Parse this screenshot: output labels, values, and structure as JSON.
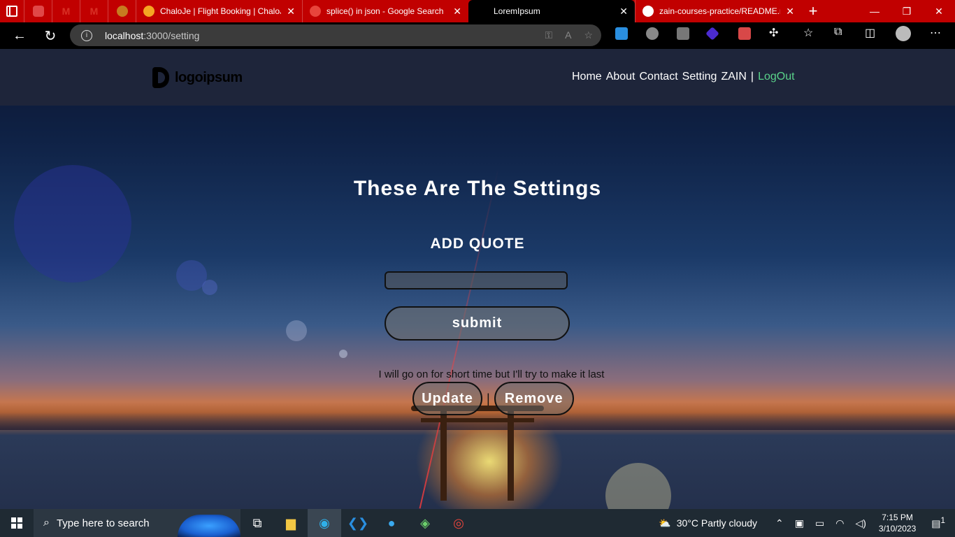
{
  "browser": {
    "tabs": [
      {
        "title": "ChaloJe | Flight Booking | ChaloJe",
        "fav_color": "#f5a623"
      },
      {
        "title": "splice() in json - Google Search",
        "fav_color": "#e8453c"
      },
      {
        "title": "LoremIpsum",
        "fav_color": "#000000",
        "active": true
      },
      {
        "title": "zain-courses-practice/README.md",
        "fav_color": "#ffffff"
      }
    ],
    "pinned_tab_colors": [
      "#e04848",
      "#d93025",
      "#d93025",
      "#c77b20"
    ],
    "address": {
      "host": "localhost",
      "path": ":3000/setting"
    },
    "window_controls": {
      "minimize": "—",
      "maximize": "❐",
      "close": "✕"
    }
  },
  "site": {
    "logo_text": "logoipsum",
    "nav": {
      "home": "Home",
      "about": "About",
      "contact": "Contact",
      "setting": "Setting",
      "user": "ZAIN",
      "separator": "|",
      "logout": "LogOut"
    },
    "heading": "These Are The Settings",
    "subheading": "ADD QUOTE",
    "quote_input": {
      "value": "",
      "placeholder": ""
    },
    "submit_label": "submit",
    "quote": "I will go on for short time but I'll try to make it last",
    "update_label": "Update",
    "remove_label": "Remove",
    "button_separator": "|"
  },
  "taskbar": {
    "search_placeholder": "Type here to search",
    "weather": {
      "temp": "30°C",
      "desc": "Partly cloudy"
    },
    "time": "7:15 PM",
    "date": "3/10/2023",
    "notification_count": "1"
  },
  "colors": {
    "tabstrip": "#c10000",
    "nav_bg": "#1e253a",
    "logout": "#5ad38a"
  }
}
